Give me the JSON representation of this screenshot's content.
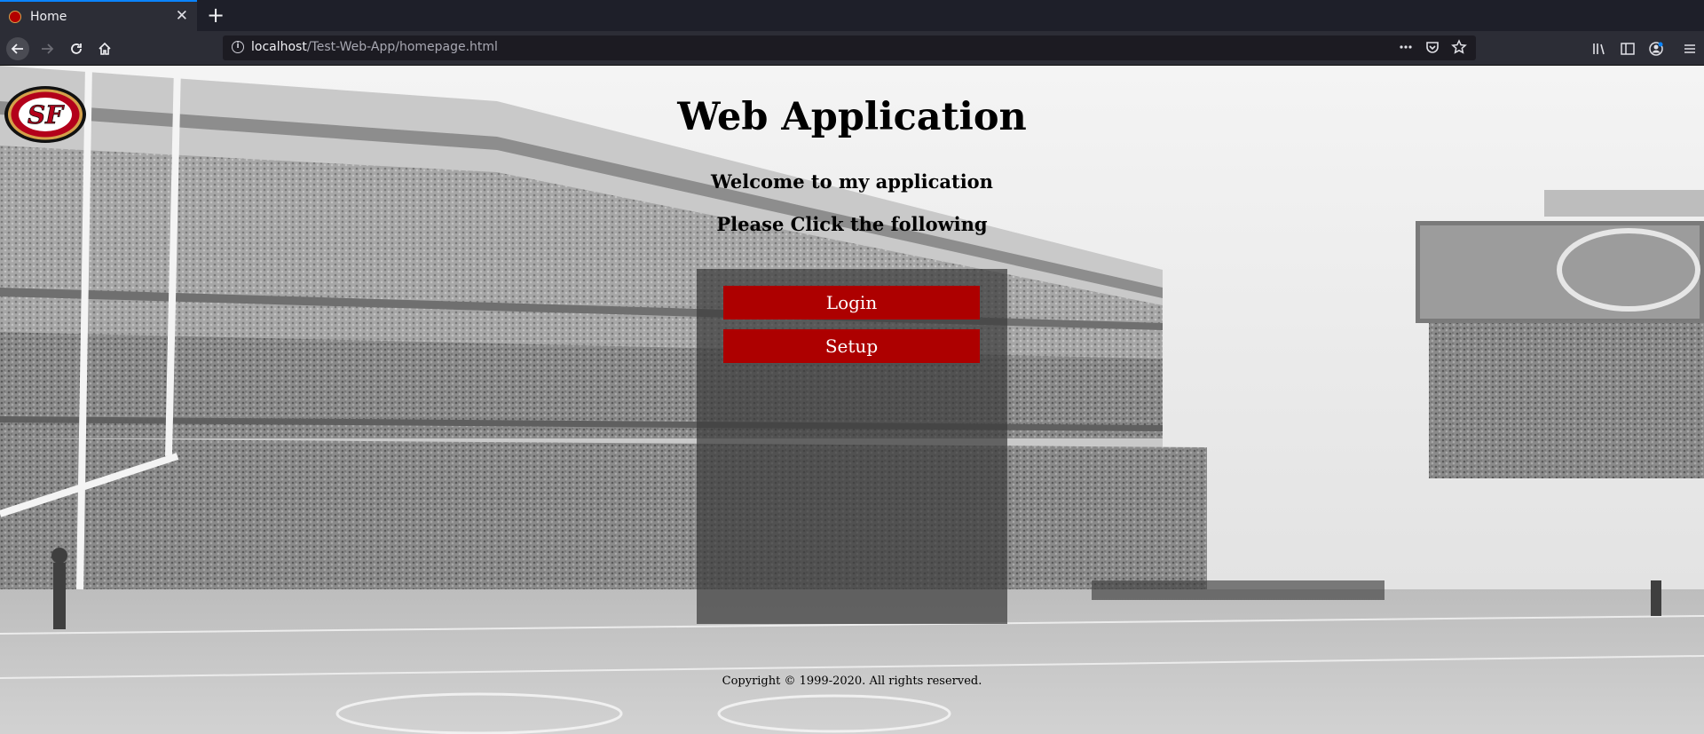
{
  "browser": {
    "tab_title": "Home",
    "url_host": "localhost",
    "url_path": "/Test-Web-App/homepage.html"
  },
  "page": {
    "title": "Web Application",
    "welcome": "Welcome to my application",
    "instruction": "Please Click the following",
    "buttons": {
      "login": "Login",
      "setup": "Setup"
    },
    "copyright": "Copyright © 1999-2020. All rights reserved.",
    "logo_text": "SF"
  },
  "colors": {
    "button_bg": "#ad0000",
    "tab_accent": "#0a84ff"
  }
}
